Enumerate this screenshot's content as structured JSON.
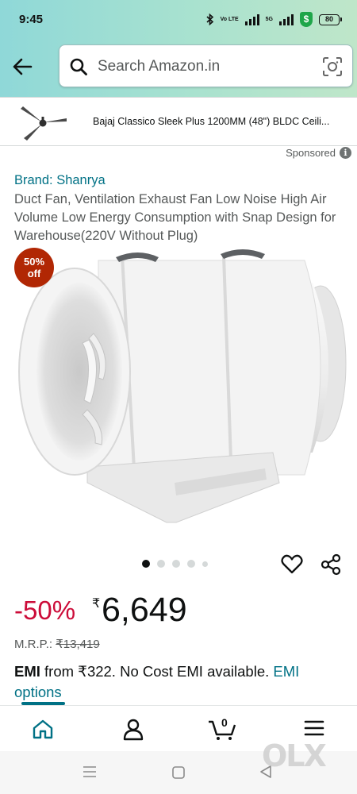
{
  "status_bar": {
    "time": "9:45",
    "network_label_1": "Vo LTE",
    "network_label_2": "5G",
    "battery": "80"
  },
  "search": {
    "placeholder": "Search Amazon.in"
  },
  "banner": {
    "product_text": "Bajaj Classico Sleek Plus 1200MM (48\") BLDC Ceili..."
  },
  "sponsored_label": "Sponsored",
  "product": {
    "brand": "Brand: Shanrya",
    "title": "Duct Fan, Ventilation Exhaust Fan Low Noise High Air Volume Low Energy Consumption with Snap Design for Warehouse(220V Without Plug)",
    "badge_percent": "50%",
    "badge_word": "off",
    "image_count": 5,
    "active_image_index": 0,
    "discount": "-50%",
    "currency_symbol": "₹",
    "price": "6,649",
    "mrp_label": "M.R.P.:",
    "mrp_value": "₹13,419",
    "emi_bold": "EMI",
    "emi_text": " from ₹322. No Cost EMI available. ",
    "emi_link": "EMI options"
  },
  "bottom_nav": {
    "items": [
      "home-icon",
      "account-icon",
      "cart-icon",
      "menu-icon"
    ],
    "cart_count": "0"
  },
  "watermark": "OLX",
  "colors": {
    "link": "#007185",
    "discount": "#cc0c39",
    "badge": "#b12704"
  }
}
